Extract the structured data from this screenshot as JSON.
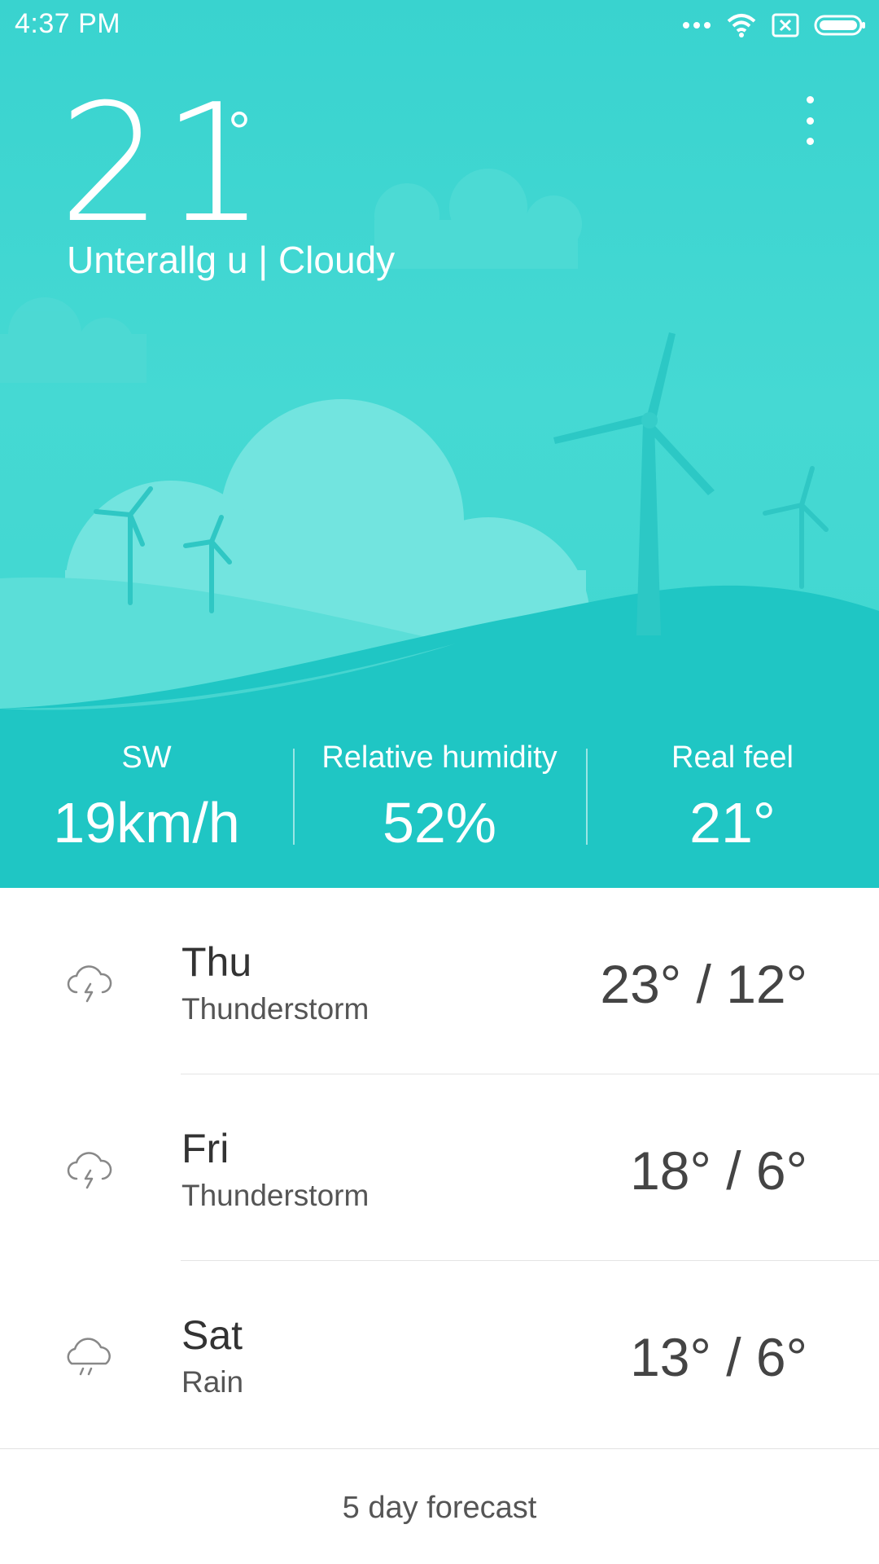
{
  "status_bar": {
    "time": "4:37 PM",
    "icons": [
      "more-dots-icon",
      "wifi-icon",
      "sim-off-icon",
      "battery-icon"
    ]
  },
  "hero": {
    "temperature": "21",
    "degree_symbol": "°",
    "location": "Unterallg    u | Cloudy",
    "menu_icon": "more-vertical-icon"
  },
  "stats": [
    {
      "label": "SW",
      "value": "19km/h"
    },
    {
      "label": "Relative humidity",
      "value": "52%"
    },
    {
      "label": "Real feel",
      "value": "21°"
    }
  ],
  "forecast": [
    {
      "day": "Thu",
      "condition": "Thunderstorm",
      "temps": "23° / 12°",
      "icon": "thunderstorm-icon"
    },
    {
      "day": "Fri",
      "condition": "Thunderstorm",
      "temps": "18° / 6°",
      "icon": "thunderstorm-icon"
    },
    {
      "day": "Sat",
      "condition": "Rain",
      "temps": "13° / 6°",
      "icon": "rain-icon"
    }
  ],
  "footer": {
    "label": "5 day forecast"
  },
  "colors": {
    "accent": "#3ed6cf",
    "hill_light": "#5fe0da",
    "hill_dark": "#1ec6c4"
  }
}
